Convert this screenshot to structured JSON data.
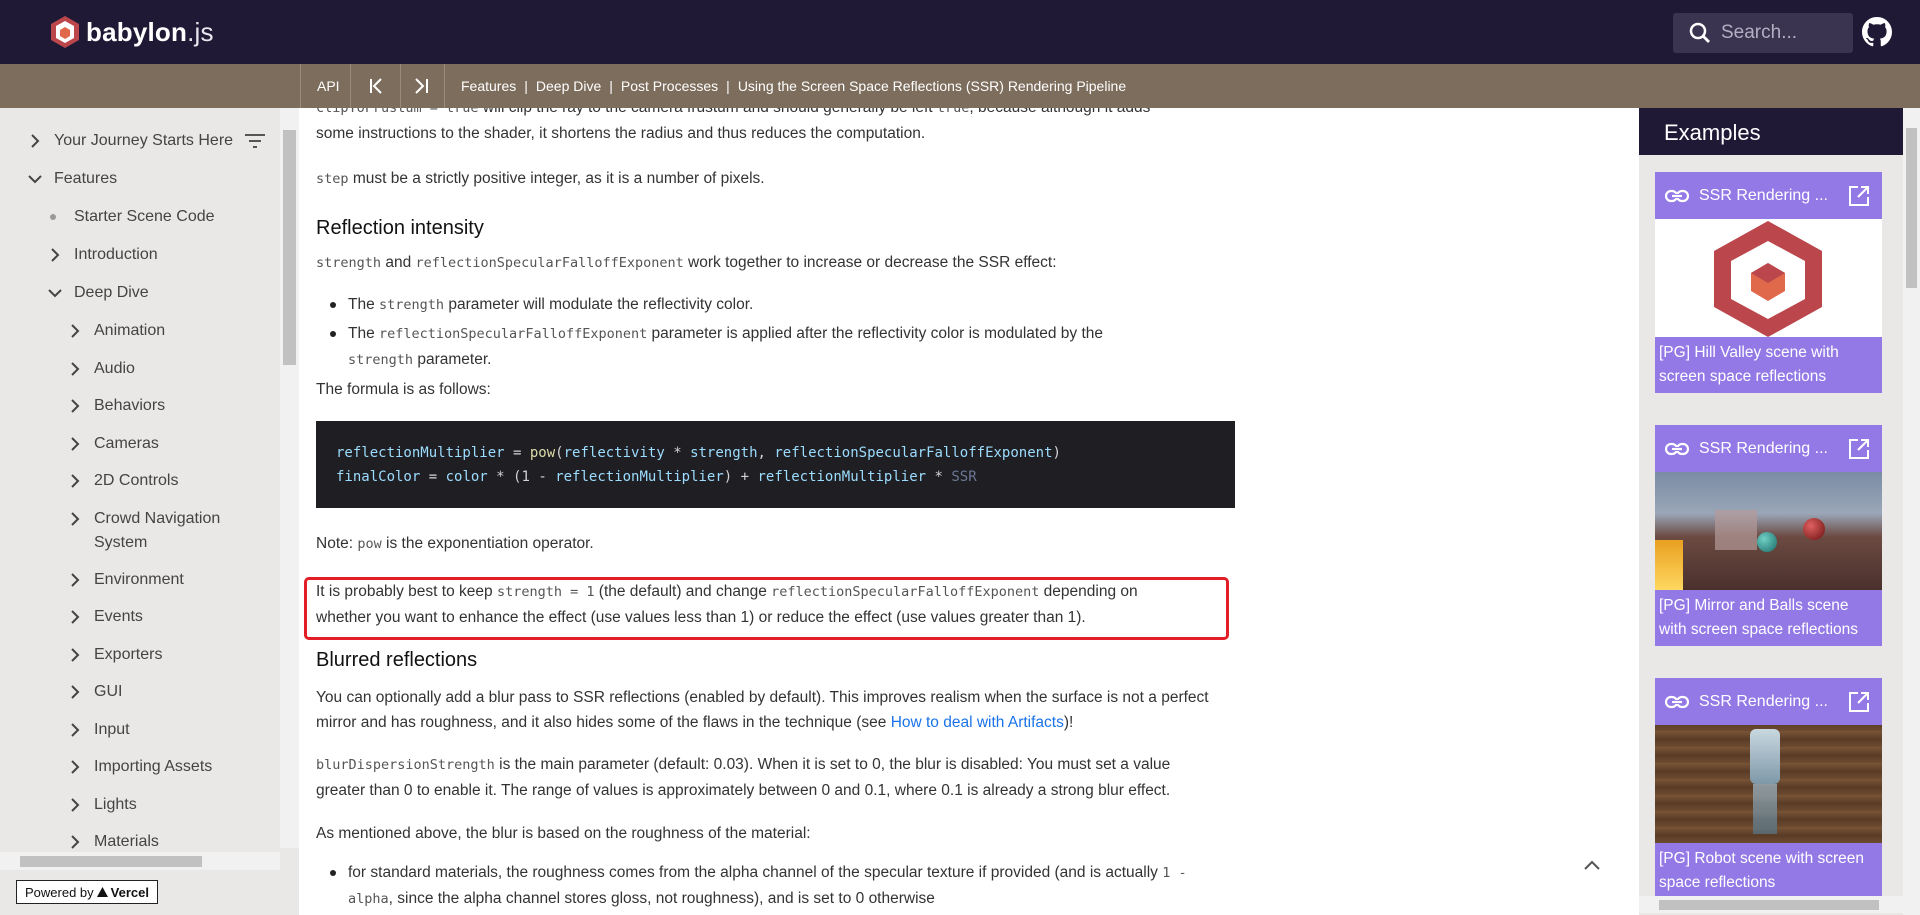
{
  "header": {
    "logo_bold": "babylon",
    "logo_light": ".js",
    "search_placeholder": "Search..."
  },
  "breadcrumb": {
    "api": "API",
    "items": [
      "Features",
      "Deep Dive",
      "Post Processes",
      "Using the Screen Space Reflections (SSR) Rendering Pipeline"
    ],
    "separator": "|"
  },
  "sidebar": {
    "items": [
      {
        "label": "Your Journey Starts Here",
        "state": "collapsed"
      },
      {
        "label": "Features",
        "state": "expanded"
      },
      {
        "label": "Starter Scene Code",
        "state": "leaf"
      },
      {
        "label": "Introduction",
        "state": "collapsed"
      },
      {
        "label": "Deep Dive",
        "state": "expanded"
      },
      {
        "label": "Animation",
        "state": "collapsed"
      },
      {
        "label": "Audio",
        "state": "collapsed"
      },
      {
        "label": "Behaviors",
        "state": "collapsed"
      },
      {
        "label": "Cameras",
        "state": "collapsed"
      },
      {
        "label": "2D Controls",
        "state": "collapsed"
      },
      {
        "label": "Crowd Navigation",
        "label2": "System",
        "state": "collapsed"
      },
      {
        "label": "Environment",
        "state": "collapsed"
      },
      {
        "label": "Events",
        "state": "collapsed"
      },
      {
        "label": "Exporters",
        "state": "collapsed"
      },
      {
        "label": "GUI",
        "state": "collapsed"
      },
      {
        "label": "Input",
        "state": "collapsed"
      },
      {
        "label": "Importing Assets",
        "state": "collapsed"
      },
      {
        "label": "Lights",
        "state": "collapsed"
      },
      {
        "label": "Materials",
        "state": "collapsed"
      }
    ],
    "powered_by": "Powered by",
    "vercel": "Vercel"
  },
  "content": {
    "p0a_code": "clipToFrustum = true",
    "p0a": " will clip the ray to the camera frustum and should generally be left ",
    "p0a_code2": "true",
    "p0a_tail": ", because although it adds",
    "p0b": "some instructions to the shader, it shortens the radius and thus reduces the computation.",
    "p1_code": "step",
    "p1": " must be a strictly positive integer, as it is a number of pixels.",
    "h_intensity": "Reflection intensity",
    "p2_code1": "strength",
    "p2_mid": " and ",
    "p2_code2": "reflectionSpecularFalloffExponent",
    "p2_tail": " work together to increase or decrease the SSR effect:",
    "li1_pre": "The ",
    "li1_code": "strength",
    "li1_tail": " parameter will modulate the reflectivity color.",
    "li2_pre": "The ",
    "li2_code": "reflectionSpecularFalloffExponent",
    "li2_tail": " parameter is applied after the reflectivity color is modulated by the",
    "li2_code2": "strength",
    "li2_tail2": " parameter.",
    "formula_intro": "The formula is as follows:",
    "code_line1": {
      "a": "reflectionMultiplier",
      "b": " = ",
      "c": "pow",
      "d": "(",
      "e": "reflectivity",
      "f": " * ",
      "g": "strength",
      "h": ", ",
      "i": "reflectionSpecularFalloffExponent",
      "j": ")"
    },
    "code_line2": {
      "a": "finalColor",
      "b": " = ",
      "c": "color",
      "d": " * (",
      "e": "1",
      "f": " - ",
      "g": "reflectionMultiplier",
      "h": ") + ",
      "i": "reflectionMultiplier",
      "j": " * ",
      "k": "SSR"
    },
    "note_pre": "Note: ",
    "note_code": "pow",
    "note_tail": " is the exponentiation operator.",
    "hl_pre": "It is probably best to keep ",
    "hl_code": "strength = 1",
    "hl_mid": " (the default) and change ",
    "hl_code2": "reflectionSpecularFalloffExponent",
    "hl_tail": " depending on",
    "hl_line2": "whether you want to enhance the effect (use values less than 1) or reduce the effect (use values greater than 1).",
    "h_blur": "Blurred reflections",
    "blur_p1a": "You can optionally add a blur pass to SSR reflections (enabled by default). This improves realism when the surface is not a perfect",
    "blur_p1b": "mirror and has roughness, and it also hides some of the flaws in the technique (see ",
    "blur_link": "How to deal with Artifacts",
    "blur_p1c": ")!",
    "blur_p2_code": "blurDispersionStrength",
    "blur_p2a": " is the main parameter (default: 0.03). When it is set to 0, the blur is disabled: You must set a value",
    "blur_p2b": "greater than 0 to enable it. The range of values is approximately between 0 and 0.1, where 0.1 is already a strong blur effect.",
    "blur_p3": "As mentioned above, the blur is based on the roughness of the material:",
    "blur_li1a": "for standard materials, the roughness comes from the alpha channel of the specular texture if provided (and is actually ",
    "blur_li1_code": "1 -",
    "blur_li1_code2": "alpha",
    "blur_li1b": ", since the alpha channel stores gloss, not roughness), and is set to 0 otherwise"
  },
  "examples": {
    "title": "Examples",
    "cards": [
      {
        "title": "SSR Rendering ...",
        "caption": "[PG] Hill Valley scene with screen space reflections"
      },
      {
        "title": "SSR Rendering ...",
        "caption": "[PG] Mirror and Balls scene with screen space reflections"
      },
      {
        "title": "SSR Rendering ...",
        "caption": "[PG] Robot scene with screen space reflections"
      }
    ]
  },
  "colors": {
    "header_bg": "#201936",
    "crumb_bg": "#7d6d5c",
    "accent_purple": "#9379e6",
    "highlight_red": "#e21e26",
    "logo_red": "#e0684b"
  }
}
